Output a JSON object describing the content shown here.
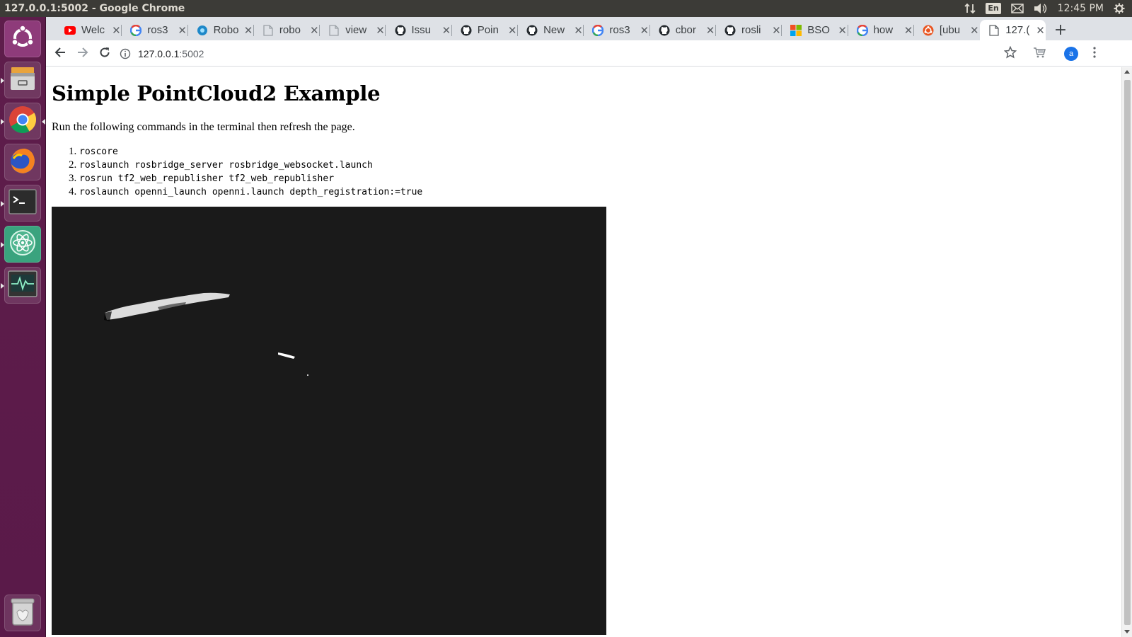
{
  "top_panel": {
    "window_title": "127.0.0.1:5002 - Google Chrome",
    "language": "En",
    "clock": "12:45 PM"
  },
  "launcher": {
    "items": [
      {
        "name": "ubuntu-dash",
        "icon": "ubuntu-logo-icon"
      },
      {
        "name": "files",
        "icon": "file-cabinet-icon"
      },
      {
        "name": "google-chrome",
        "icon": "chrome-icon"
      },
      {
        "name": "firefox",
        "icon": "firefox-icon"
      },
      {
        "name": "terminal",
        "icon": "terminal-icon"
      },
      {
        "name": "atom",
        "icon": "atom-icon"
      },
      {
        "name": "system-monitor",
        "icon": "system-monitor-icon"
      },
      {
        "name": "trash",
        "icon": "trash-icon"
      }
    ]
  },
  "tabs": [
    {
      "label": "Welc",
      "icon": "youtube-icon",
      "color": "#ff0000"
    },
    {
      "label": "ros3",
      "icon": "google-icon",
      "color": "#4285f4"
    },
    {
      "label": "Robo",
      "icon": "robot-web-icon",
      "color": "#1e88c9"
    },
    {
      "label": "robo",
      "icon": "page-icon",
      "color": "#9aa0a6"
    },
    {
      "label": "view",
      "icon": "page-icon",
      "color": "#9aa0a6"
    },
    {
      "label": "Issu",
      "icon": "github-icon",
      "color": "#24292e"
    },
    {
      "label": "Poin",
      "icon": "github-icon",
      "color": "#24292e"
    },
    {
      "label": "New",
      "icon": "github-icon",
      "color": "#24292e"
    },
    {
      "label": "ros3",
      "icon": "google-icon",
      "color": "#4285f4"
    },
    {
      "label": "cbor",
      "icon": "github-icon",
      "color": "#24292e"
    },
    {
      "label": "rosli",
      "icon": "github-icon",
      "color": "#24292e"
    },
    {
      "label": "BSO",
      "icon": "microsoft-icon",
      "color": "#f25022"
    },
    {
      "label": "how",
      "icon": "google-icon",
      "color": "#4285f4"
    },
    {
      "label": "[ubu",
      "icon": "ubuntu-icon",
      "color": "#e95420"
    },
    {
      "label": "127.(",
      "icon": "page-icon",
      "color": "#5f6368"
    }
  ],
  "omnibox": {
    "host": "127.0.0.1",
    "port": ":5002"
  },
  "profile": {
    "initial": "a"
  },
  "page": {
    "title": "Simple PointCloud2 Example",
    "instructions": "Run the following commands in the terminal then refresh the page.",
    "commands": [
      "roscore",
      "roslaunch rosbridge_server rosbridge_websocket.launch",
      "rosrun tf2_web_republisher tf2_web_republisher",
      "roslaunch openni_launch openni.launch depth_registration:=true"
    ]
  },
  "colors": {
    "ubuntu_panel": "#3c3b37",
    "launcher": "#5e1d4b",
    "tab_strip": "#dee1e6",
    "viewer_bg": "#1a1a1a"
  }
}
